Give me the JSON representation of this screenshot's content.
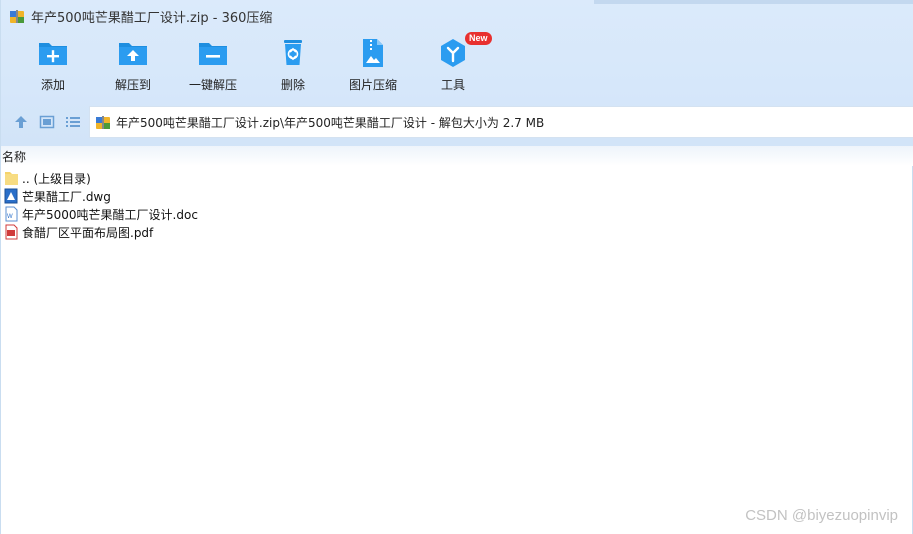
{
  "window": {
    "title": "年产500吨芒果醋工厂设计.zip - 360压缩",
    "title_icon": "archive-icon"
  },
  "toolbar": {
    "items": [
      {
        "label": "添加",
        "icon": "add-folder-icon"
      },
      {
        "label": "解压到",
        "icon": "extract-folder-icon"
      },
      {
        "label": "一键解压",
        "icon": "one-click-extract-icon"
      },
      {
        "label": "删除",
        "icon": "recycle-bin-icon"
      },
      {
        "label": "图片压缩",
        "icon": "image-compress-icon"
      },
      {
        "label": "工具",
        "icon": "tools-icon",
        "badge": "New"
      }
    ]
  },
  "navbar": {
    "up_icon": "up-arrow-icon",
    "view_thumb_icon": "thumbnail-view-icon",
    "view_list_icon": "list-view-icon",
    "address": "年产500吨芒果醋工厂设计.zip\\年产500吨芒果醋工厂设计 - 解包大小为 2.7 MB"
  },
  "list": {
    "column_name": "名称",
    "rows": [
      {
        "name": ".. (上级目录)",
        "icon": "folder-icon"
      },
      {
        "name": "芒果醋工厂.dwg",
        "icon": "dwg-file-icon"
      },
      {
        "name": "年产5000吨芒果醋工厂设计.doc",
        "icon": "doc-file-icon"
      },
      {
        "name": "食醋厂区平面布局图.pdf",
        "icon": "pdf-file-icon"
      }
    ]
  },
  "watermark": "CSDN @biyezuopinvip",
  "colors": {
    "accent": "#1e8ee0",
    "toolbar_bg": "#d6e7fa",
    "badge": "#e8302f"
  }
}
